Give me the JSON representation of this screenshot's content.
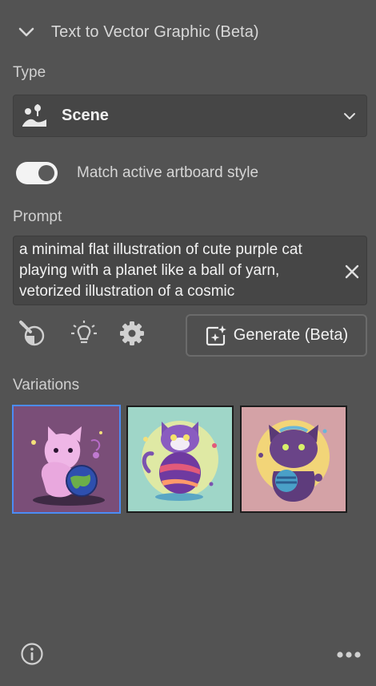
{
  "header": {
    "title": "Text to Vector Graphic (Beta)"
  },
  "type": {
    "label": "Type",
    "selected": "Scene",
    "icon": "scene-icon"
  },
  "toggle": {
    "label": "Match active artboard style",
    "on": true
  },
  "prompt": {
    "label": "Prompt",
    "value": "a minimal flat illustration of cute purple cat playing with a planet like a ball of yarn, vetorized illustration of a cosmic"
  },
  "toolbar": {
    "icons": [
      "eyedropper-icon",
      "lightbulb-icon",
      "gear-icon"
    ],
    "generate_label": "Generate (Beta)"
  },
  "variations": {
    "label": "Variations",
    "items": [
      {
        "background": "#7a4e78",
        "selected": true
      },
      {
        "background": "#9fd6c8",
        "selected": false
      },
      {
        "background": "#d4a2a6",
        "selected": false
      }
    ]
  },
  "colors": {
    "panel": "#535353",
    "field": "#464646",
    "accent": "#4b8cf5"
  }
}
